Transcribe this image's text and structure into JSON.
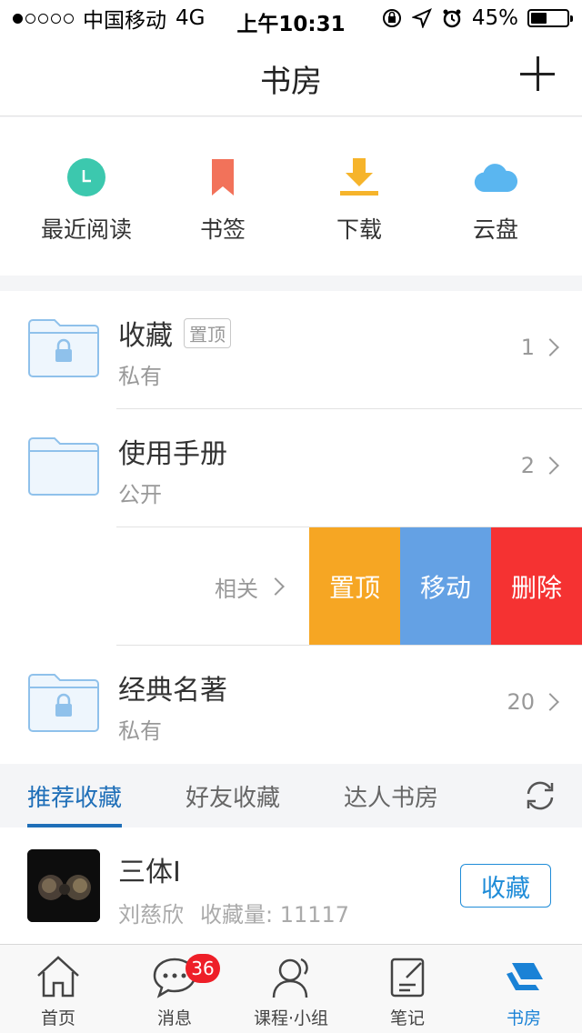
{
  "status_bar": {
    "carrier": "中国移动",
    "network": "4G",
    "time": "上午10:31",
    "battery": "45%",
    "battery_level": 0.45
  },
  "header": {
    "title": "书房",
    "add_icon": "plus-icon"
  },
  "quick_entries": [
    {
      "label": "最近阅读",
      "icon": "clock-icon",
      "color": "#3cc8ae"
    },
    {
      "label": "书签",
      "icon": "bookmark-icon",
      "color": "#f2725a"
    },
    {
      "label": "下载",
      "icon": "download-icon",
      "color": "#f6b42b"
    },
    {
      "label": "云盘",
      "icon": "cloud-icon",
      "color": "#5ab6f0"
    }
  ],
  "folders": [
    {
      "title": "收藏",
      "tag": "置顶",
      "visibility": "私有",
      "count": "1",
      "locked": true
    },
    {
      "title": "使用手册",
      "visibility": "公开",
      "count": "2",
      "locked": false
    },
    {
      "related_label": "相关",
      "actions": {
        "pin": "置顶",
        "move": "移动",
        "delete": "删除"
      }
    },
    {
      "title": "经典名著",
      "visibility": "私有",
      "count": "20",
      "locked": true
    }
  ],
  "tabs": [
    {
      "label": "推荐收藏",
      "active": true
    },
    {
      "label": "好友收藏",
      "active": false
    },
    {
      "label": "达人书房",
      "active": false
    }
  ],
  "recommendation": {
    "title": "三体I",
    "author": "刘慈欣",
    "collect_count": "收藏量: 11117",
    "button": "收藏"
  },
  "tab_bar": [
    {
      "label": "首页",
      "icon": "home-icon",
      "active": false
    },
    {
      "label": "消息",
      "icon": "message-icon",
      "badge": "36",
      "active": false
    },
    {
      "label": "课程·小组",
      "icon": "user-group-icon",
      "active": false
    },
    {
      "label": "笔记",
      "icon": "note-icon",
      "active": false
    },
    {
      "label": "书房",
      "icon": "bookshelf-icon",
      "active": true
    }
  ],
  "colors": {
    "accent": "#1f6fb8",
    "pin_action": "#f6a623",
    "move_action": "#64a1e4",
    "delete_action": "#f53232",
    "badge": "#ee1f28"
  }
}
